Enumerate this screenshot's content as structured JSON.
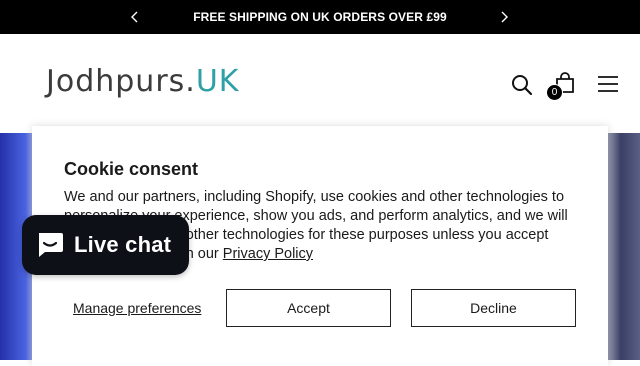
{
  "announcement": {
    "text": "FREE SHIPPING ON UK ORDERS OVER £99",
    "prev_icon": "chevron-left-icon",
    "next_icon": "chevron-right-icon"
  },
  "header": {
    "logo_main": "Jodhpurs.",
    "logo_accent": "UK",
    "cart_count": "0",
    "icons": [
      "search-icon",
      "cart-icon",
      "menu-icon"
    ]
  },
  "cookie": {
    "title": "Cookie consent",
    "body_before_link": "We and our partners, including Shopify, use cookies and other technologies to personalize your experience, show you ads, and perform analytics, and we will not use cookies or other technologies for these purposes unless you accept them. Learn more in our ",
    "policy_link": "Privacy Policy",
    "manage_label": "Manage preferences",
    "accept_label": "Accept",
    "decline_label": "Decline"
  },
  "chat": {
    "label": "Live chat",
    "icon": "chat-bubble-icon"
  },
  "colors": {
    "announcement_bg": "#000000",
    "logo_accent": "#2ea0a6",
    "chat_bg": "#0d1117"
  }
}
